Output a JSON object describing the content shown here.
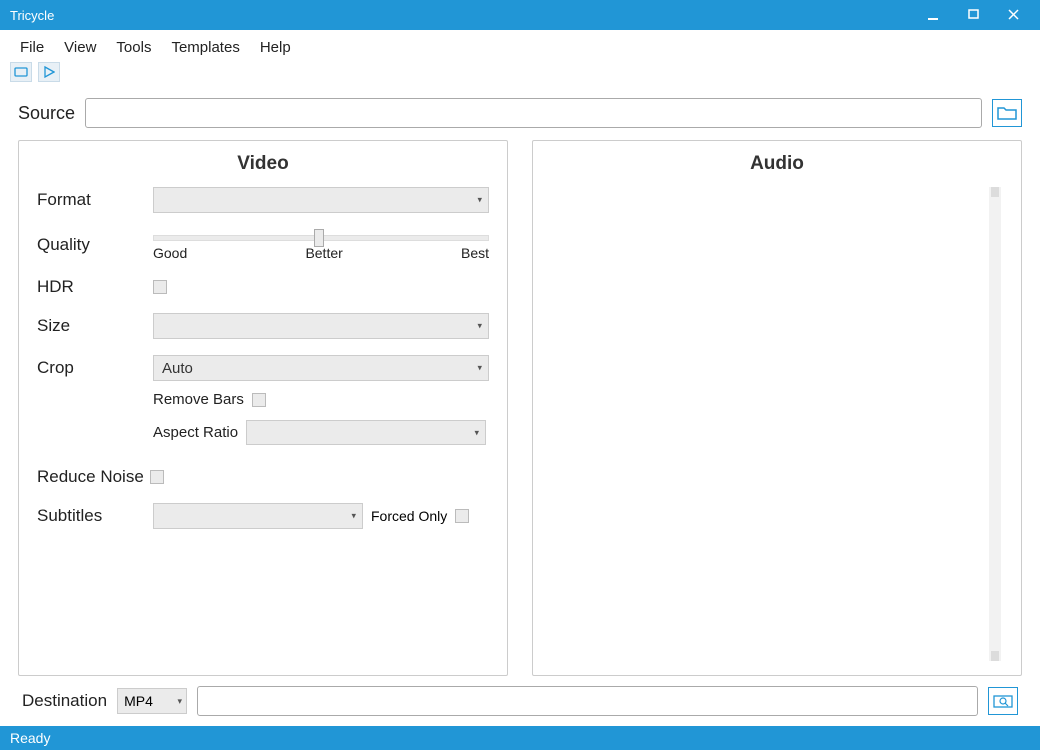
{
  "titlebar": {
    "title": "Tricycle"
  },
  "menu": {
    "items": [
      "File",
      "View",
      "Tools",
      "Templates",
      "Help"
    ]
  },
  "source": {
    "label": "Source",
    "value": ""
  },
  "panels": {
    "video_title": "Video",
    "audio_title": "Audio"
  },
  "video": {
    "format_label": "Format",
    "format_value": "",
    "quality_label": "Quality",
    "quality_good": "Good",
    "quality_better": "Better",
    "quality_best": "Best",
    "hdr_label": "HDR",
    "size_label": "Size",
    "size_value": "",
    "crop_label": "Crop",
    "crop_value": "Auto",
    "remove_bars_label": "Remove Bars",
    "aspect_ratio_label": "Aspect Ratio",
    "aspect_ratio_value": "",
    "reduce_noise_label": "Reduce Noise",
    "subtitles_label": "Subtitles",
    "subtitles_value": "",
    "forced_only_label": "Forced Only"
  },
  "destination": {
    "label": "Destination",
    "format": "MP4",
    "path": ""
  },
  "status": {
    "text": "Ready"
  }
}
